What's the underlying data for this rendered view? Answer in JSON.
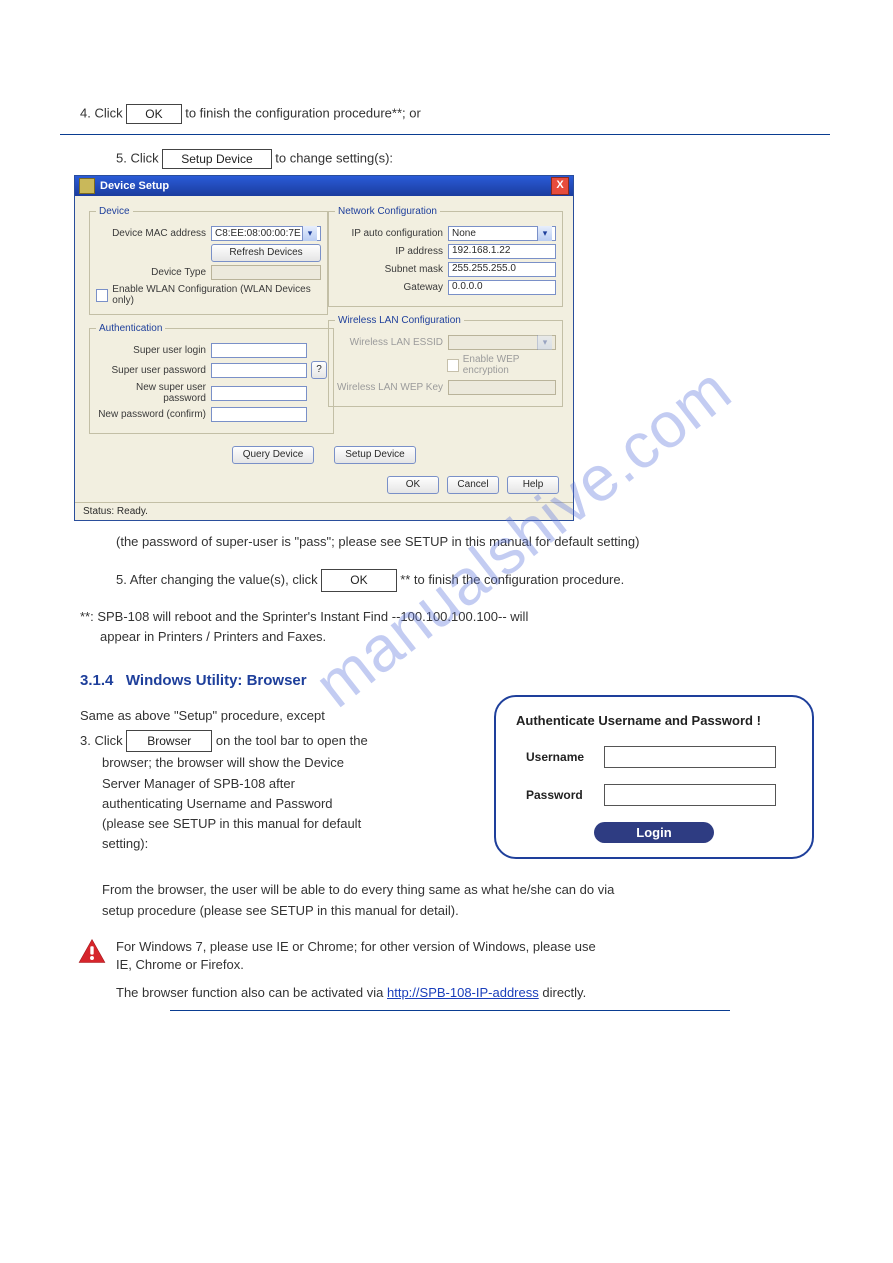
{
  "watermark": "manualshive.com",
  "step4": {
    "pre": "4.  Click",
    "btn": "OK",
    "post": "to finish the configuration procedure**; or"
  },
  "step5": {
    "pre": "5.  Click",
    "btn": "Setup Device",
    "post": "to change setting(s):"
  },
  "win": {
    "title": "Device Setup",
    "close": "X",
    "device": {
      "legend": "Device",
      "mac_label": "Device MAC address",
      "mac_value": "C8:EE:08:00:00:7E",
      "refresh": "Refresh Devices",
      "type_label": "Device Type",
      "type_value": "",
      "wlan_chk": "Enable WLAN Configuration (WLAN Devices only)"
    },
    "net": {
      "legend": "Network Configuration",
      "autoconf_label": "IP auto configuration",
      "autoconf_value": "None",
      "ip_label": "IP address",
      "ip_value": "192.168.1.22",
      "mask_label": "Subnet mask",
      "mask_value": "255.255.255.0",
      "gw_label": "Gateway",
      "gw_value": "0.0.0.0"
    },
    "auth": {
      "legend": "Authentication",
      "login_label": "Super user login",
      "pwd_label": "Super user password",
      "pwd_help": "?",
      "newpwd_label": "New super user password",
      "conf_label": "New password (confirm)"
    },
    "wlan": {
      "legend": "Wireless LAN Configuration",
      "essid_label": "Wireless LAN ESSID",
      "wep_chk": "Enable WEP encryption",
      "wepkey_label": "Wireless LAN WEP Key"
    },
    "query": "Query Device",
    "setup": "Setup Device",
    "ok": "OK",
    "cancel": "Cancel",
    "help": "Help",
    "status": "Status: Ready."
  },
  "post_win": {
    "p1": "(the password of super-user is \"pass\"; please see SETUP in this manual for default setting)",
    "p2_pre": "5.  After changing the value(s), click",
    "p2_btn": "OK",
    "p2_post": "** to finish the configuration procedure.",
    "note1": "**: SPB-108 will reboot and the Sprinter's Instant Find --100.100.100.100-- will",
    "note2": "appear in Printers / Printers and Faxes."
  },
  "section": {
    "num": "3.1.4",
    "title": "Windows Utility: Browser"
  },
  "browser_intro": {
    "l1": "Same as above \"Setup\" procedure, except",
    "l2a": "3.  Click",
    "l2_btn": "Browser",
    "l2b": "on the tool bar to open the",
    "l3": "browser; the browser will show the Device",
    "l4": "Server Manager of SPB-108 after",
    "l5": "authenticating Username and Password",
    "l6": "(please see SETUP in this manual for default",
    "l7": "setting):"
  },
  "authbox": {
    "title": "Authenticate Username and Password !",
    "user": "Username",
    "pass": "Password",
    "login": "Login"
  },
  "after_auth": {
    "l1": "From the browser, the user will be able to do every thing same as what he/she can do via",
    "l2": "setup procedure (please see SETUP in this manual for detail)."
  },
  "warn": {
    "t1": "For Windows 7, please use IE or Chrome; for other version of Windows, please use",
    "t2": "IE, Chrome or Firefox.",
    "t3": "The browser function also can be activated via",
    "link": "http://SPB-108-IP-address",
    "t4": "directly."
  }
}
